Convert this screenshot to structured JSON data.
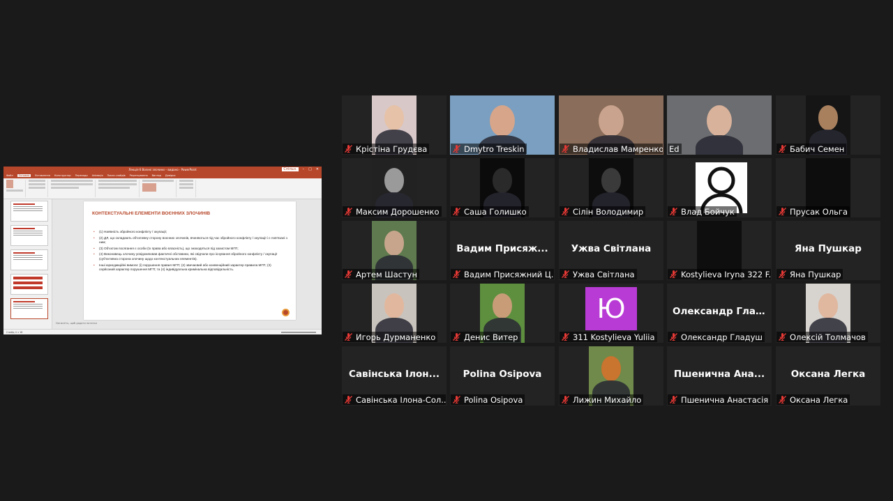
{
  "shared_screen": {
    "window_title": "Лекція 6 Воєнні злочини – видано - PowerPoint",
    "share_btn": "Спільн.",
    "ribbon_tabs": [
      "Файл",
      "Основне",
      "Вставлення",
      "Конструктор",
      "Переходи",
      "Анімація",
      "Показ слайдів",
      "Рецензування",
      "Вигляд",
      "Довідка"
    ],
    "slide_title": "КОНТЕКСТУАЛЬНІ ЕЛЕМЕНТИ ВОЄННИХ ЗЛОЧИНІВ",
    "bullets": [
      "(1) Наявність збройного конфлікту / окупації;",
      "(2) ДЛ, що складають об'єктивну сторону воєнних злочинів, вчиняються під час збройного конфлікту / окупації і є пов'язані з ним;",
      "(3) Об'єктом посягання є особи (їх права або власність), що знаходяться під захистом МГП;",
      "(4) Виконавець злочину усвідомлював фактичні обставини, які свідчили про існування збройного конфлікту / окупації (суб'єктивна сторона злочину щодо контекстуальних елементів).",
      "Інші юрисдикційні вимоги: (і) порушення правил МГП; (2) звичаєвий або конвенційний характер правила МГП; (3) серйозний характер порушення МГП; та (4) індивідуальна кримінальна відповідальність."
    ],
    "notes_placeholder": "Натисніть, щоб додати нотатки",
    "status": "Слайд 4 з 18"
  },
  "participants": [
    {
      "name": "Крістіна Грудєва",
      "center": "",
      "video": "#d8c8c8",
      "face": "#e6c2a8"
    },
    {
      "name": "Dmytro Treskin",
      "center": "",
      "video": "#7a9fc0",
      "face": "#d6a58a"
    },
    {
      "name": "Владислав Мамренко",
      "center": "",
      "video": "#8a6d5a",
      "face": "#c9a38d"
    },
    {
      "name": "Ed",
      "center": "",
      "video": "#6b6d70",
      "face": "#d9b29b",
      "active": true
    },
    {
      "name": "Бабич Семен",
      "center": "",
      "video": "#151515",
      "face": "#a8805e"
    },
    {
      "name": "Максим Дорошенко",
      "center": "",
      "video": "#222",
      "face": "#9a9a9a"
    },
    {
      "name": "Саша Голишко",
      "center": "",
      "video": "#0b0b0b",
      "face": "#2a2a2a"
    },
    {
      "name": "Сілін Володимир",
      "center": "",
      "video": "#0d0d0d",
      "face": "#3a3a3a"
    },
    {
      "name": "Влад Бойчук",
      "center": "",
      "video": "#ffffff",
      "face": "#000000",
      "generic": true
    },
    {
      "name": "Прусак Ольга",
      "center": "",
      "video": "#0d0d0d",
      "face": ""
    },
    {
      "name": "Артем Шастун",
      "center": "",
      "video": "#5e7a4e",
      "face": "#c7a58c"
    },
    {
      "name": "Вадим Присяжний Ц...",
      "center": "Вадим  Присяж...",
      "video": "",
      "face": ""
    },
    {
      "name": "Ужва Світлана",
      "center": "Ужва Світлана",
      "video": "",
      "face": ""
    },
    {
      "name": "Kostylieva Iryna 322 F...",
      "center": "",
      "video": "#0e0e0e",
      "face": ""
    },
    {
      "name": "Яна Пушкар",
      "center": "Яна Пушкар",
      "video": "",
      "face": ""
    },
    {
      "name": "Игорь Дурманенко",
      "center": "",
      "video": "#c9c3bd",
      "face": "#e1b89e"
    },
    {
      "name": "Денис Витер",
      "center": "",
      "video": "#5d8f3e",
      "face": "#c99c78"
    },
    {
      "name": "311 Kostylieva Yuliia",
      "center": "",
      "letter": "Ю",
      "video": "",
      "face": ""
    },
    {
      "name": "Олександр Гладуш",
      "center": "Олександр  Гла...",
      "video": "",
      "face": ""
    },
    {
      "name": "Олексій Толмачов",
      "center": "",
      "video": "#d7d3ce",
      "face": "#e0b79f"
    },
    {
      "name": "Савінська Ілона-Сол...",
      "center": "Савінська  Ілон...",
      "video": "",
      "face": ""
    },
    {
      "name": "Polina Osipova",
      "center": "Polina Osipova",
      "video": "",
      "face": ""
    },
    {
      "name": "Лижин Михайло",
      "center": "",
      "video": "#6f8a4a",
      "face": "#c9742f"
    },
    {
      "name": "Пшенична Анастасія",
      "center": "Пшенична  Ана...",
      "video": "",
      "face": ""
    },
    {
      "name": "Оксана Легка",
      "center": "Оксана Легка",
      "video": "",
      "face": ""
    }
  ]
}
